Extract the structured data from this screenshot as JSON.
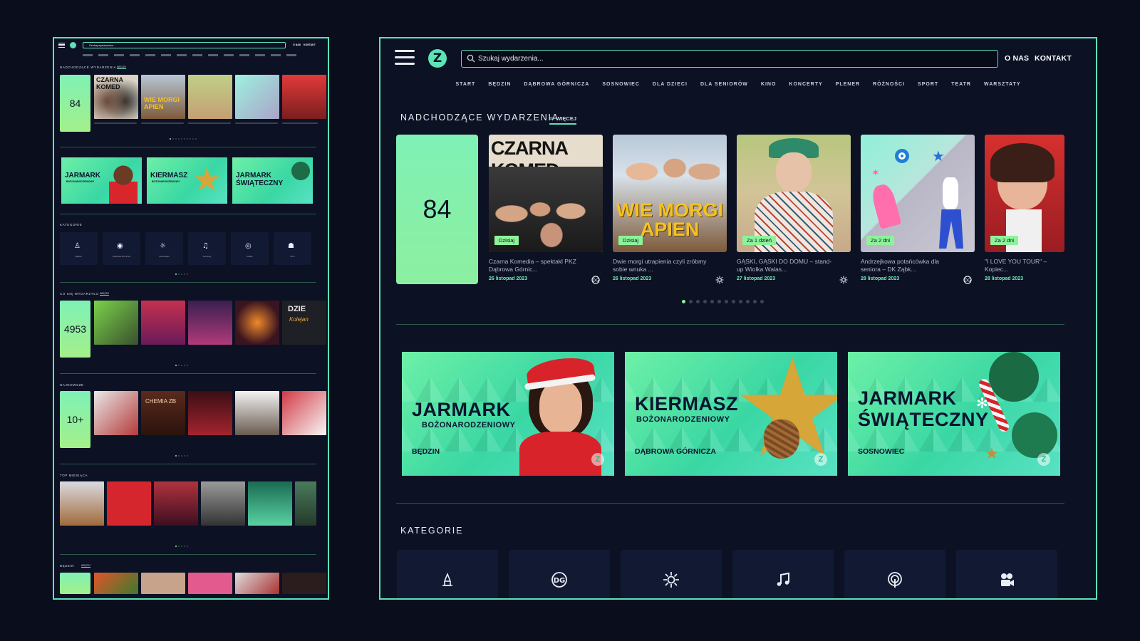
{
  "search": {
    "placeholder": "Szukaj wydarzenia..."
  },
  "header": {
    "about": "O NAS",
    "contact": "KONTAKT"
  },
  "nav": [
    "START",
    "BĘDZIN",
    "DĄBROWA GÓRNICZA",
    "SOSNOWIEC",
    "DLA DZIECI",
    "DLA SENIORÓW",
    "KINO",
    "KONCERTY",
    "PLENER",
    "RÓŻNOŚCI",
    "SPORT",
    "TEATR",
    "WARSZTATY"
  ],
  "upcoming": {
    "title": "NADCHODZĄCE WYDARZENIA",
    "more": "WIĘCEJ",
    "count": "84",
    "cards": [
      {
        "badge": "Dzisiaj",
        "title": "Czarna Komedia – spektakl PKZ Dąbrowa Górnic...",
        "date": "26 listopad 2023",
        "icon": "dg-icon",
        "img": "CZARNA KOMED"
      },
      {
        "badge": "Dzisiaj",
        "title": "Dwie morgi utrapienia czyli zróbmy sobie wnuka ...",
        "date": "26 listopad 2023",
        "icon": "sosnowiec-icon",
        "img": "DWIE MORGI UTRAPIENIA"
      },
      {
        "badge": "Za 1 dzień",
        "title": "GĄSKI, GĄSKI DO DOMU – stand-up Wiolka Walas...",
        "date": "27 listopad 2023",
        "icon": "sosnowiec-icon",
        "img": ""
      },
      {
        "badge": "Za 2 dni",
        "title": "Andrzejkowa potańcówka dla seniora – DK Ząbk...",
        "date": "28 listopad 2023",
        "icon": "dg-icon",
        "img": ""
      },
      {
        "badge": "Za 2 dni",
        "title": "\"I LOVE YOU TOUR\" – Kopiec...",
        "date": "28 listopad 2023",
        "icon": "dg-icon",
        "img": ""
      }
    ]
  },
  "banners": [
    {
      "line1": "JARMARK",
      "line2": "BOŻONARODZENIOWY",
      "city": "BĘDZIN"
    },
    {
      "line1": "KIERMASZ",
      "line2": "BOŻONARODZENIOWY",
      "city": "DĄBROWA GÓRNICZA"
    },
    {
      "line1": "JARMARK",
      "line1b": "ŚWIĄTECZNY",
      "city": "SOSNOWIEC"
    }
  ],
  "categories": {
    "title": "KATEGORIE",
    "items": [
      "Będzin",
      "Dąbrowa Górnicza",
      "Sosnowiec",
      "Koncerty",
      "Online",
      "Kino"
    ]
  },
  "mini": {
    "sections": [
      "NADCHODZĄCE WYDARZENIA",
      "KATEGORIE",
      "CO SIĘ WYDARZYŁO",
      "NAJNOWSZE",
      "TOP MIESIĄCA",
      "BĘDZIN"
    ],
    "counts": [
      "84",
      "4953",
      "10+"
    ],
    "more": "WIĘCEJ"
  },
  "colors": {
    "accent": "#5ce3b6",
    "badge": "#8df29a",
    "background": "#0c1124"
  }
}
